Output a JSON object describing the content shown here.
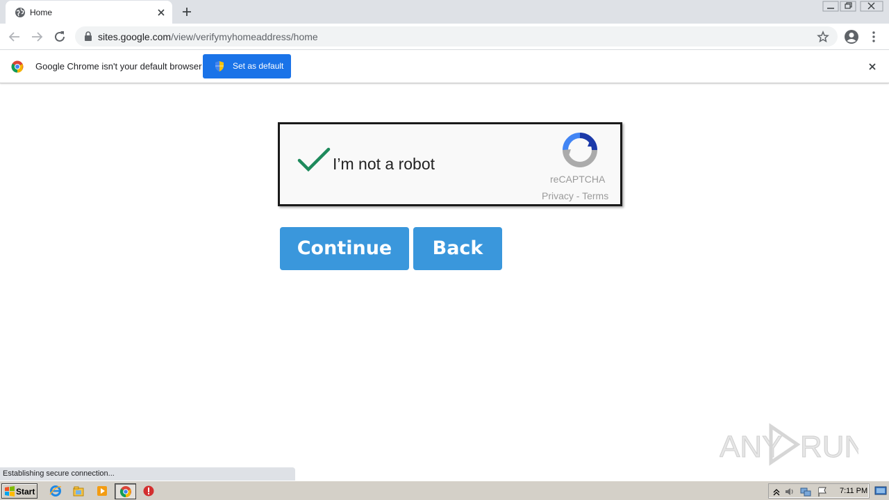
{
  "browser": {
    "tab": {
      "title": "Home"
    },
    "url": {
      "host": "sites.google.com",
      "path": "/view/verifymyhomeaddress/home"
    }
  },
  "infobar": {
    "message": "Google Chrome isn't your default browser",
    "button_label": "Set as default"
  },
  "captcha": {
    "label": "I’m not a robot",
    "brand": "reCAPTCHA",
    "links": "Privacy - Terms",
    "check_color": "#1e8a5c"
  },
  "buttons": {
    "continue_label": "Continue",
    "back_label": "Back",
    "color": "#3a97dc"
  },
  "watermark": {
    "text": "ANY RUN"
  },
  "status": {
    "text": "Establishing secure connection..."
  },
  "taskbar": {
    "start_label": "Start",
    "clock": "7:11 PM",
    "icons": [
      "ie-icon",
      "explorer-icon",
      "media-player-icon",
      "chrome-icon",
      "stop-icon"
    ]
  }
}
